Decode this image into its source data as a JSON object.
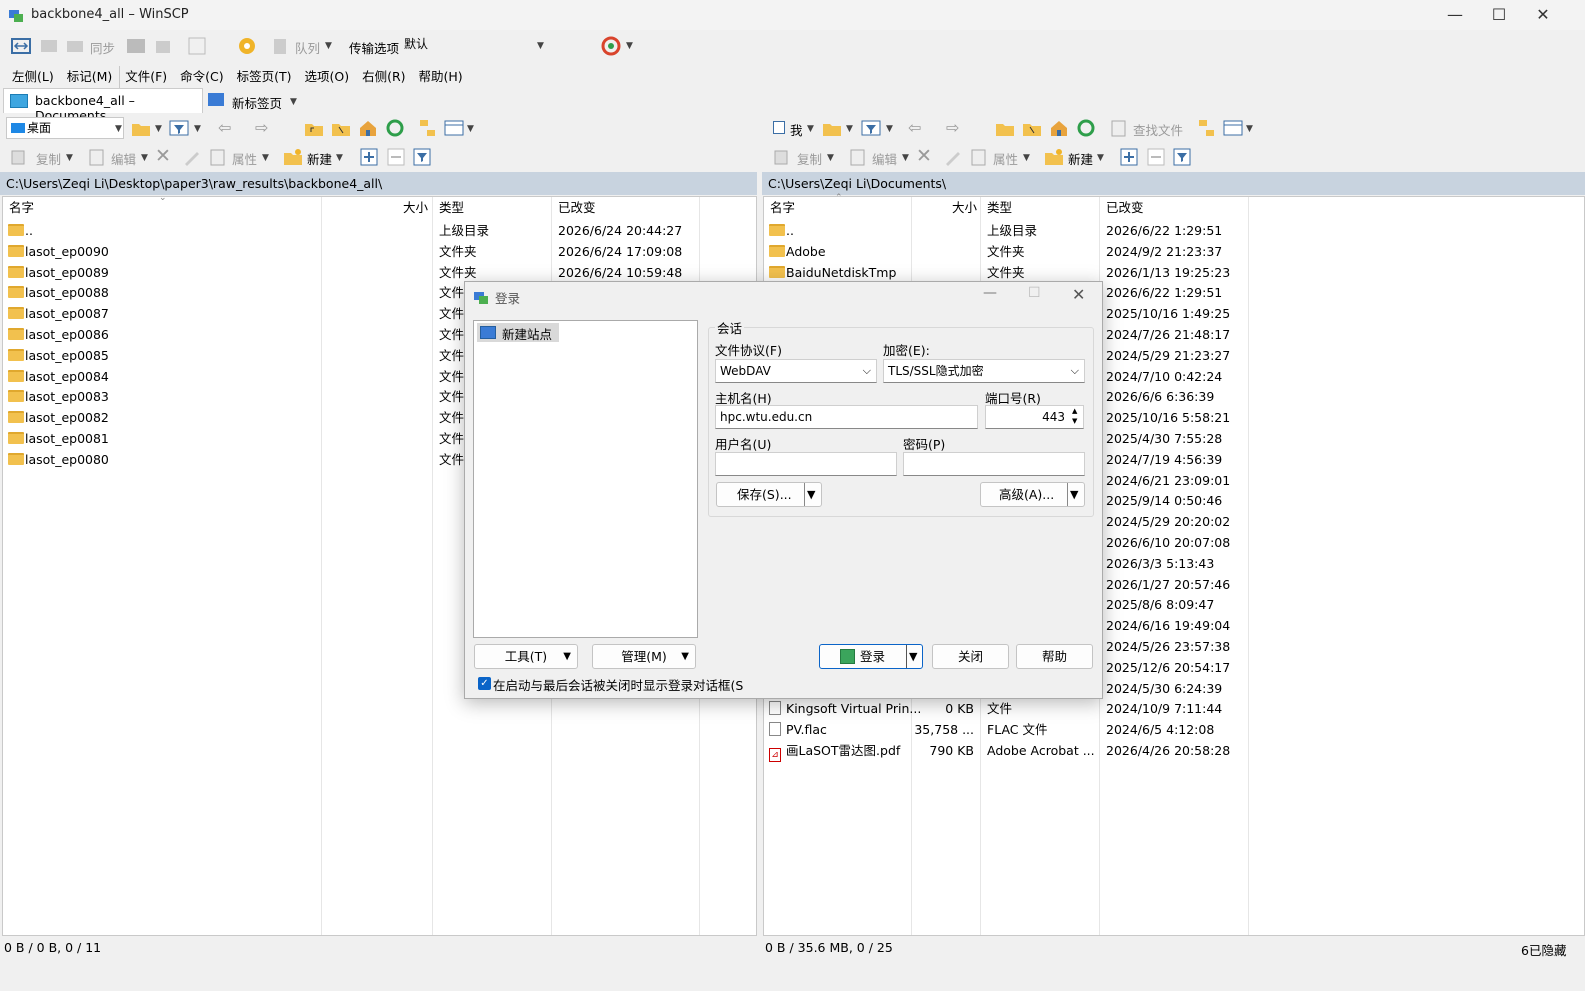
{
  "window": {
    "title": "backbone4_all – WinSCP",
    "minimize": "—",
    "maximize": "☐",
    "close": "✕"
  },
  "toolbar1": {
    "sync_label": "同步",
    "queue_label": "队列",
    "transfer_label": "传输选项",
    "transfer_value": "默认"
  },
  "menu": {
    "items": [
      "左侧(L)",
      "标记(M)",
      "文件(F)",
      "命令(C)",
      "标签页(T)",
      "选项(O)",
      "右侧(R)",
      "帮助(H)"
    ]
  },
  "tabs": {
    "session": "backbone4_all – Documents",
    "new_tab": "新标签页"
  },
  "left": {
    "location": "桌面",
    "actions": {
      "copy": "复制",
      "edit": "编辑",
      "props": "属性",
      "new": "新建"
    },
    "path": "C:\\Users\\Zeqi Li\\Desktop\\paper3\\raw_results\\backbone4_all\\",
    "headers": {
      "name": "名字",
      "size": "大小",
      "type": "类型",
      "changed": "已改变"
    },
    "rows": [
      {
        "name": "..",
        "size": "",
        "type": "上级目录",
        "changed": "2026/6/24 20:44:27",
        "icon": "parent-dir"
      },
      {
        "name": "lasot_ep0090",
        "size": "",
        "type": "文件夹",
        "changed": "2026/6/24 17:09:08",
        "icon": "folder"
      },
      {
        "name": "lasot_ep0089",
        "size": "",
        "type": "文件夹",
        "changed": "2026/6/24 10:59:48",
        "icon": "folder"
      },
      {
        "name": "lasot_ep0088",
        "size": "",
        "type": "文件夹",
        "changed": "",
        "icon": "folder"
      },
      {
        "name": "lasot_ep0087",
        "size": "",
        "type": "文件夹",
        "changed": "",
        "icon": "folder"
      },
      {
        "name": "lasot_ep0086",
        "size": "",
        "type": "文件夹",
        "changed": "",
        "icon": "folder"
      },
      {
        "name": "lasot_ep0085",
        "size": "",
        "type": "文件夹",
        "changed": "",
        "icon": "folder"
      },
      {
        "name": "lasot_ep0084",
        "size": "",
        "type": "文件夹",
        "changed": "",
        "icon": "folder"
      },
      {
        "name": "lasot_ep0083",
        "size": "",
        "type": "文件夹",
        "changed": "",
        "icon": "folder"
      },
      {
        "name": "lasot_ep0082",
        "size": "",
        "type": "文件夹",
        "changed": "",
        "icon": "folder"
      },
      {
        "name": "lasot_ep0081",
        "size": "",
        "type": "文件夹",
        "changed": "",
        "icon": "folder"
      },
      {
        "name": "lasot_ep0080",
        "size": "",
        "type": "文件夹",
        "changed": "",
        "icon": "folder"
      }
    ],
    "status": "0 B / 0 B,   0 / 11"
  },
  "right": {
    "location": "我",
    "find_label": "查找文件",
    "actions": {
      "copy": "复制",
      "edit": "编辑",
      "props": "属性",
      "new": "新建"
    },
    "path": "C:\\Users\\Zeqi Li\\Documents\\",
    "headers": {
      "name": "名字",
      "size": "大小",
      "type": "类型",
      "changed": "已改变"
    },
    "rows": [
      {
        "name": "..",
        "size": "",
        "type": "上级目录",
        "changed": "2026/6/22 1:29:51",
        "icon": "parent-dir"
      },
      {
        "name": "Adobe",
        "size": "",
        "type": "文件夹",
        "changed": "2024/9/2 21:23:37",
        "icon": "folder"
      },
      {
        "name": "BaiduNetdiskTmp",
        "size": "",
        "type": "文件夹",
        "changed": "2026/1/13 19:25:23",
        "icon": "folder"
      },
      {
        "name": "",
        "size": "",
        "type": "",
        "changed": "2026/6/22 1:29:51",
        "icon": ""
      },
      {
        "name": "",
        "size": "",
        "type": "",
        "changed": "2025/10/16 1:49:25",
        "icon": ""
      },
      {
        "name": "",
        "size": "",
        "type": "",
        "changed": "2024/7/26 21:48:17",
        "icon": ""
      },
      {
        "name": "",
        "size": "",
        "type": "",
        "changed": "2024/5/29 21:23:27",
        "icon": ""
      },
      {
        "name": "",
        "size": "",
        "type": "",
        "changed": "2024/7/10 0:42:24",
        "icon": ""
      },
      {
        "name": "",
        "size": "",
        "type": "",
        "changed": "2026/6/6 6:36:39",
        "icon": ""
      },
      {
        "name": "",
        "size": "",
        "type": "",
        "changed": "2025/10/16 5:58:21",
        "icon": ""
      },
      {
        "name": "",
        "size": "",
        "type": "",
        "changed": "2025/4/30 7:55:28",
        "icon": ""
      },
      {
        "name": "",
        "size": "",
        "type": "",
        "changed": "2024/7/19 4:56:39",
        "icon": ""
      },
      {
        "name": "",
        "size": "",
        "type": "",
        "changed": "2024/6/21 23:09:01",
        "icon": ""
      },
      {
        "name": "",
        "size": "",
        "type": "",
        "changed": "2025/9/14 0:50:46",
        "icon": ""
      },
      {
        "name": "",
        "size": "",
        "type": "",
        "changed": "2024/5/29 20:20:02",
        "icon": ""
      },
      {
        "name": "",
        "size": "",
        "type": "",
        "changed": "2026/6/10 20:07:08",
        "icon": ""
      },
      {
        "name": "",
        "size": "",
        "type": "",
        "changed": "2026/3/3 5:13:43",
        "icon": ""
      },
      {
        "name": "",
        "size": "",
        "type": "",
        "changed": "2026/1/27 20:57:46",
        "icon": ""
      },
      {
        "name": "",
        "size": "",
        "type": "",
        "changed": "2025/8/6 8:09:47",
        "icon": ""
      },
      {
        "name": "",
        "size": "",
        "type": "",
        "changed": "2024/6/16 19:49:04",
        "icon": ""
      },
      {
        "name": "",
        "size": "",
        "type": "",
        "changed": "2024/5/26 23:57:38",
        "icon": ""
      },
      {
        "name": "",
        "size": "",
        "type": "",
        "changed": "2025/12/6 20:54:17",
        "icon": ""
      },
      {
        "name": "",
        "size": "",
        "type": "",
        "changed": "2024/5/30 6:24:39",
        "icon": ""
      },
      {
        "name": "Kingsoft Virtual Prin...",
        "size": "0 KB",
        "type": "文件",
        "changed": "2024/10/9 7:11:44",
        "icon": "file"
      },
      {
        "name": "PV.flac",
        "size": "35,758 ...",
        "type": "FLAC 文件",
        "changed": "2024/6/5 4:12:08",
        "icon": "file"
      },
      {
        "name": "画LaSOT雷达图.pdf",
        "size": "790 KB",
        "type": "Adobe Acrobat ...",
        "changed": "2026/4/26 20:58:28",
        "icon": "pdf"
      }
    ],
    "status": "0 B / 35.6 MB,   0 / 25",
    "hidden": "6已隐藏"
  },
  "dialog": {
    "title": "登录",
    "site_new": "新建站点",
    "group": "会话",
    "protocol_label": "文件协议(F)",
    "protocol_value": "WebDAV",
    "encryption_label": "加密(E):",
    "encryption_value": "TLS/SSL隐式加密",
    "host_label": "主机名(H)",
    "host_value": "hpc.wtu.edu.cn",
    "port_label": "端口号(R)",
    "port_value": "443",
    "user_label": "用户名(U)",
    "user_value": "",
    "pass_label": "密码(P)",
    "pass_value": "",
    "save_btn": "保存(S)...",
    "advanced_btn": "高级(A)...",
    "tools_btn": "工具(T)",
    "manage_btn": "管理(M)",
    "login_btn": "登录",
    "close_btn": "关闭",
    "help_btn": "帮助",
    "checkbox_label": "在启动与最后会话被关闭时显示登录对话框(S",
    "checkbox_checked": true
  },
  "colors": {
    "path_bar": "#c8d3df",
    "accent": "#0a64c8",
    "folder": "#f2c14e"
  }
}
